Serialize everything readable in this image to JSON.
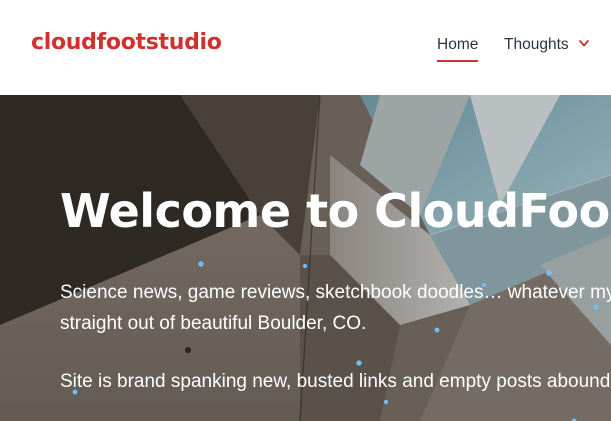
{
  "header": {
    "site_title": "cloudfootstudio",
    "nav": {
      "home_label": "Home",
      "thoughts_label": "Thoughts"
    },
    "accent_color": "#d0312d"
  },
  "hero": {
    "title": "Welcome to CloudFoo",
    "paragraph1_line1": "Science news, game reviews, sketchbook doodles… whatever my",
    "paragraph1_line2": "straight out of beautiful Boulder, CO.",
    "paragraph2": "Site is brand spanking new, busted links and empty posts abound"
  },
  "icons": {
    "thoughts_dropdown": "chevron-down-icon"
  }
}
